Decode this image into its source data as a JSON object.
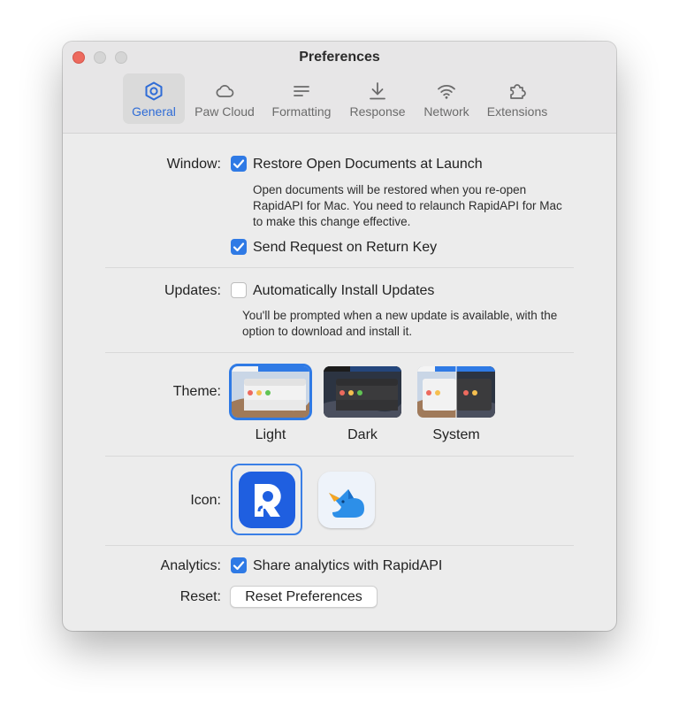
{
  "window": {
    "title": "Preferences"
  },
  "tabs": [
    {
      "label": "General",
      "icon": "gear-hexagon-icon",
      "active": true
    },
    {
      "label": "Paw Cloud",
      "icon": "cloud-icon",
      "active": false
    },
    {
      "label": "Formatting",
      "icon": "text-lines-icon",
      "active": false
    },
    {
      "label": "Response",
      "icon": "download-arrow-icon",
      "active": false
    },
    {
      "label": "Network",
      "icon": "wifi-icon",
      "active": false
    },
    {
      "label": "Extensions",
      "icon": "puzzle-piece-icon",
      "active": false
    }
  ],
  "general": {
    "window_label": "Window:",
    "restore_docs": {
      "label": "Restore Open Documents at Launch",
      "checked": true
    },
    "restore_note": [
      "Open documents will be restored when you re-open",
      "RapidAPI for Mac. You need to relaunch RapidAPI for Mac",
      "to make this change effective."
    ],
    "send_on_return": {
      "label": "Send Request on Return Key",
      "checked": true
    },
    "updates_label": "Updates:",
    "auto_updates": {
      "label": "Automatically Install Updates",
      "checked": false
    },
    "updates_note": [
      "You'll be prompted when a new update is available, with the",
      "option to download and install it."
    ],
    "theme_label": "Theme:",
    "themes": [
      {
        "label": "Light",
        "selected": true
      },
      {
        "label": "Dark",
        "selected": false
      },
      {
        "label": "System",
        "selected": false
      }
    ],
    "icon_label": "Icon:",
    "icons": [
      {
        "name": "rapidapi-app-icon",
        "selected": true
      },
      {
        "name": "paw-fox-app-icon",
        "selected": false
      }
    ],
    "analytics_label": "Analytics:",
    "analytics": {
      "label": "Share analytics with RapidAPI",
      "checked": true
    },
    "reset_label": "Reset:",
    "reset_button": "Reset Preferences"
  },
  "colors": {
    "accent": "#2f7ae5",
    "close_button": "#ed6a5e",
    "active_tab_text": "#2f6cd6"
  }
}
